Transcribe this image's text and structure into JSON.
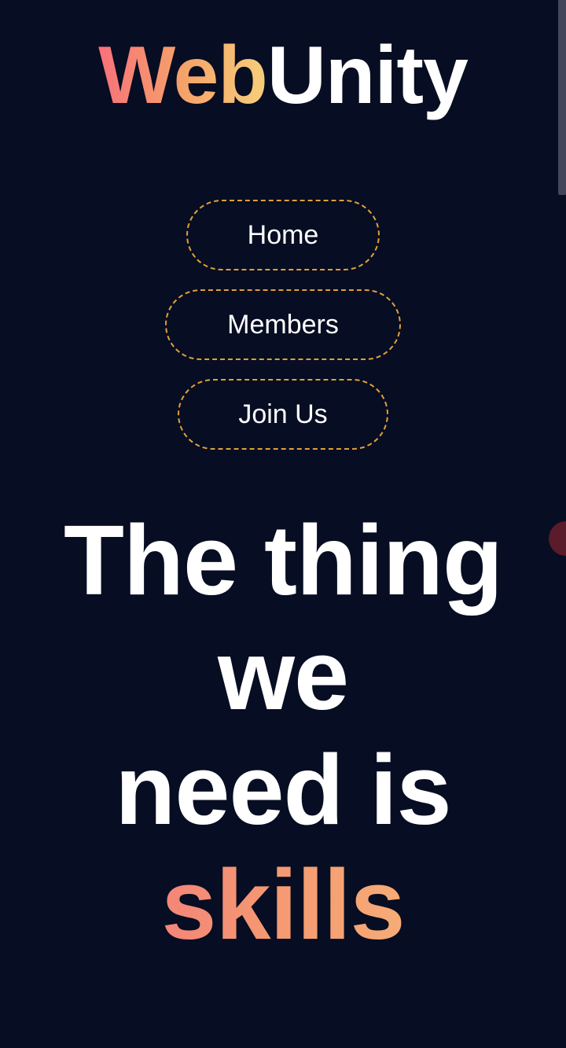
{
  "brand": {
    "logo_part1": "Web",
    "logo_part2": "Unity",
    "accent_colors": [
      "#f7717a",
      "#f5a26a",
      "#f7cf7a"
    ]
  },
  "nav": {
    "items": [
      {
        "label": "Home"
      },
      {
        "label": "Members"
      },
      {
        "label": "Join Us"
      }
    ],
    "border_color": "#e0a038"
  },
  "hero": {
    "line1": "The thing",
    "line2": "we",
    "line3": "need is",
    "highlight": "skills"
  },
  "theme": {
    "background": "#070d22",
    "text": "#ffffff"
  }
}
